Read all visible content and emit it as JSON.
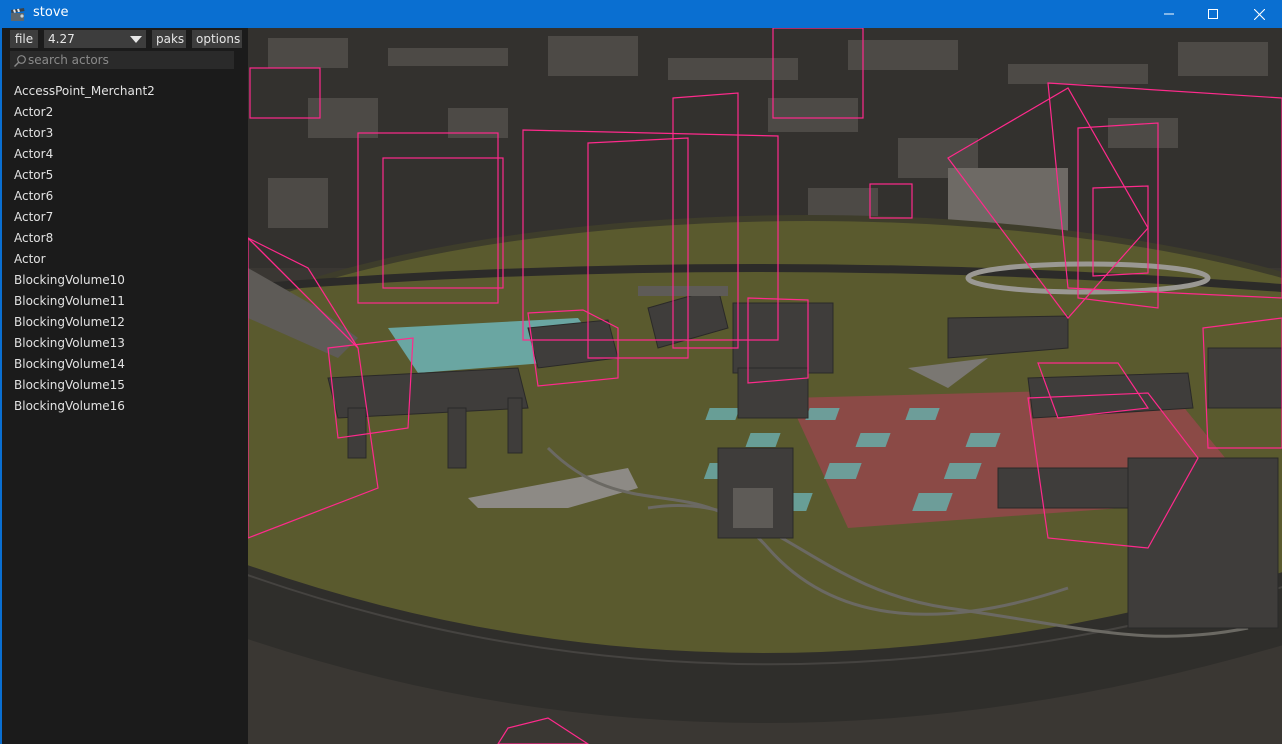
{
  "window": {
    "title": "stove",
    "icon": "clapperboard-icon"
  },
  "titlebar_controls": [
    "minimize-icon",
    "maximize-icon",
    "close-icon"
  ],
  "toolbar": {
    "file_label": "file",
    "version_value": "4.27",
    "paks_label": "paks",
    "options_label": "options"
  },
  "search": {
    "placeholder": "search actors",
    "value": ""
  },
  "actors": [
    "AccessPoint_Merchant2",
    "Actor2",
    "Actor3",
    "Actor4",
    "Actor5",
    "Actor6",
    "Actor7",
    "Actor8",
    "Actor",
    "BlockingVolume10",
    "BlockingVolume11",
    "BlockingVolume12",
    "BlockingVolume13",
    "BlockingVolume14",
    "BlockingVolume15",
    "BlockingVolume16"
  ],
  "colors": {
    "titlebar": "#0a6fd1",
    "sidebar_bg": "#1b1b1b",
    "button_bg": "#3d3d3d",
    "text": "#e2e2e2",
    "bounds_wireframe": "#ff2a8c",
    "floor": "#5a5a2e",
    "geometry": "#4a4744"
  }
}
